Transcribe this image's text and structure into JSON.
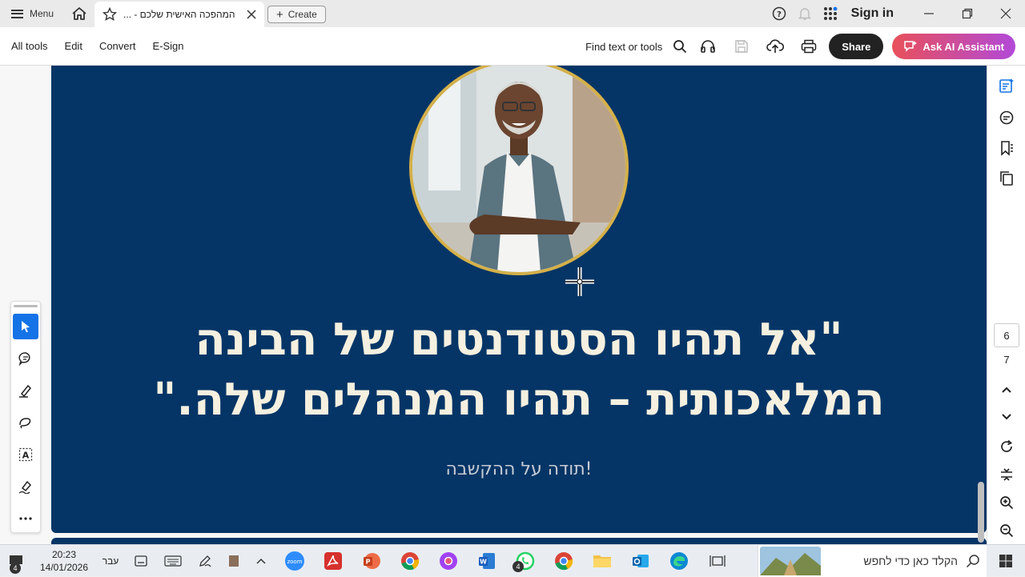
{
  "window": {
    "menu_label": "Menu",
    "tab_title": "המהפכה האישית שלכם - ...",
    "create_label": "Create",
    "sign_in_label": "Sign in"
  },
  "toolbar": {
    "menus": [
      "All tools",
      "Edit",
      "Convert",
      "E-Sign"
    ],
    "find_label": "Find text or tools",
    "share_label": "Share",
    "ai_label": "Ask AI Assistant"
  },
  "slide": {
    "quote_line1": "\"אל תהיו הסטודנטים של הבינה",
    "quote_line2": "המלאכותית – תהיו המנהלים שלה.\"",
    "thanks": "!תודה על ההקשבה",
    "colors": {
      "background": "#053566",
      "ring": "#d4b04a",
      "text": "#f5f0e0"
    }
  },
  "navigation": {
    "current_page": "6",
    "total_pages": "7"
  },
  "taskbar": {
    "time": "20:23",
    "date": "14/01/2026",
    "language": "עבר",
    "notification_count": "4",
    "whatsapp_count": "4",
    "search_placeholder": "הקלד כאן כדי לחפש"
  }
}
